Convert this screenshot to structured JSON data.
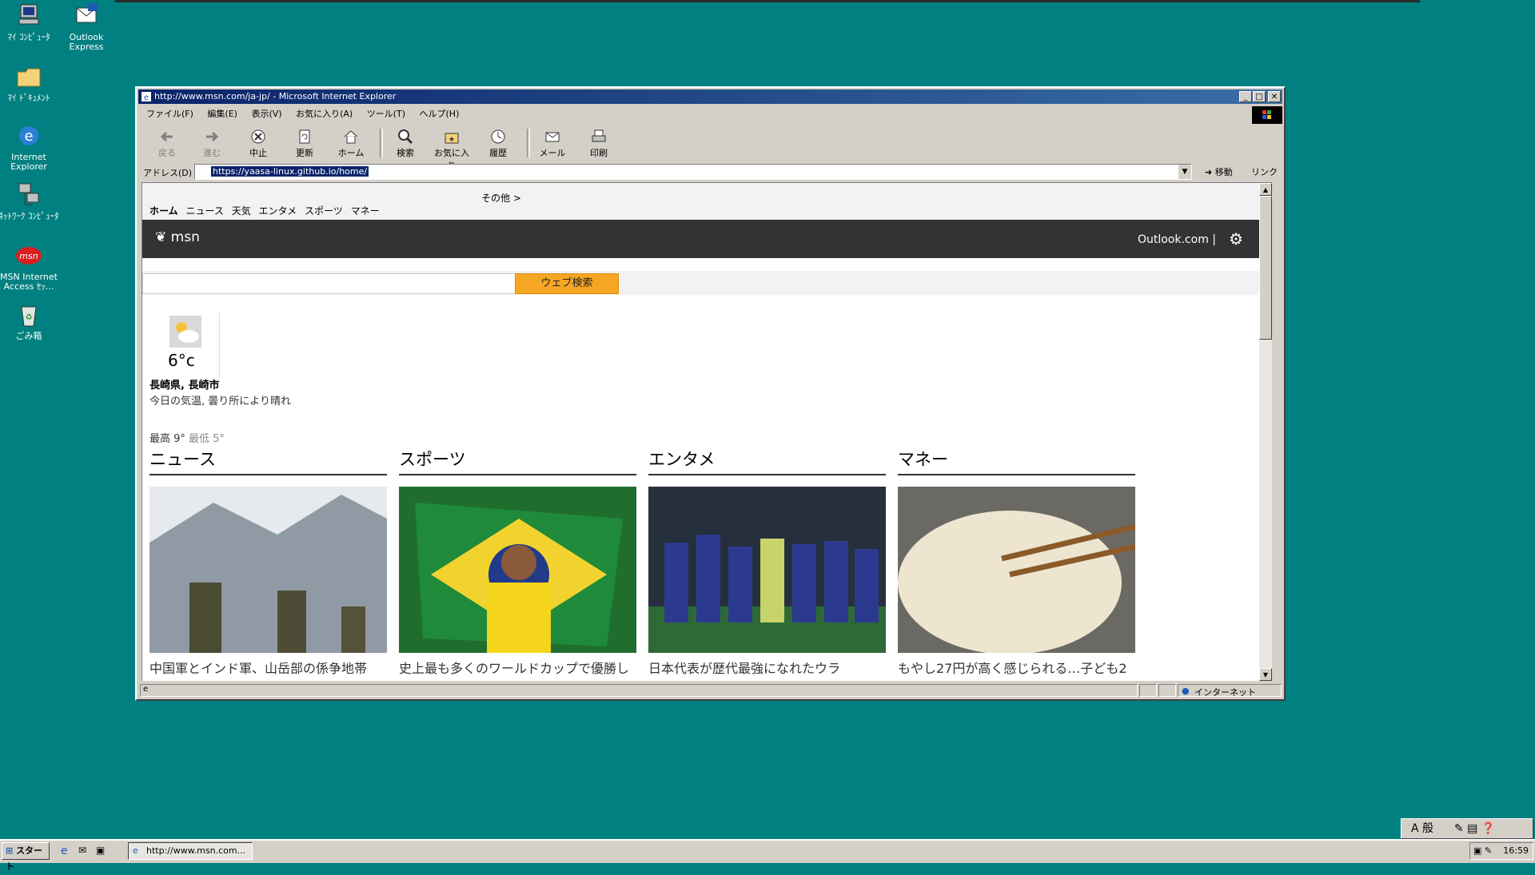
{
  "desktop": {
    "icons": [
      {
        "label": "ﾏｲ ｺﾝﾋﾟｭｰﾀ"
      },
      {
        "label": "Outlook Express"
      },
      {
        "label": "ﾏｲ ﾄﾞｷｭﾒﾝﾄ"
      },
      {
        "label": "Internet Explorer"
      },
      {
        "label": "ﾈｯﾄﾜｰｸ ｺﾝﾋﾟｭｰﾀ"
      },
      {
        "label": "MSN Internet Access ｾｯ..."
      },
      {
        "label": "ごみ箱"
      }
    ]
  },
  "window": {
    "title": "http://www.msn.com/ja-jp/ - Microsoft Internet Explorer",
    "menu": [
      "ファイル(F)",
      "編集(E)",
      "表示(V)",
      "お気に入り(A)",
      "ツール(T)",
      "ヘルプ(H)"
    ],
    "toolbar": {
      "back": "戻る",
      "forward": "進む",
      "stop": "中止",
      "refresh": "更新",
      "home": "ホーム",
      "search": "検索",
      "favorites": "お気に入り",
      "history": "履歴",
      "mail": "メール",
      "print": "印刷"
    },
    "address": {
      "label": "アドレス(D)",
      "url": "https://yaasa-linux.github.io/home/",
      "go": "移動",
      "links": "リンク"
    },
    "status": {
      "zone": "インターネット"
    }
  },
  "page": {
    "nav": {
      "items": [
        "ホーム",
        "ニュース",
        "天気",
        "エンタメ",
        "スポーツ",
        "マネー"
      ],
      "more": "その他 >"
    },
    "header": {
      "logo": "msn",
      "outlook": "Outlook.com |"
    },
    "search": {
      "button": "ウェブ検索",
      "placeholder": ""
    },
    "weather": {
      "temp": "6°c",
      "location": "長崎県, 長崎市",
      "condition": "今日の気温, 曇り所により晴れ",
      "high_label": "最高 9°",
      "low_label": "最低 5°"
    },
    "sections": [
      {
        "heading": "ニュース",
        "caption": "中国軍とインド軍、山岳部の係争地帯"
      },
      {
        "heading": "スポーツ",
        "caption": "史上最も多くのワールドカップで優勝し"
      },
      {
        "heading": "エンタメ",
        "caption": "日本代表が歴代最強になれたウラ"
      },
      {
        "heading": "マネー",
        "caption": "もやし27円が高く感じられる…子ども2"
      }
    ]
  },
  "taskbar": {
    "start": "スタート",
    "task": "http://www.msn.com...",
    "clock": "16:59",
    "ime": "A 般"
  },
  "colors": {
    "desktop": "#008080",
    "titlebar": "#0a246a",
    "search_button": "#f5a623",
    "msn_bar": "#333333"
  }
}
